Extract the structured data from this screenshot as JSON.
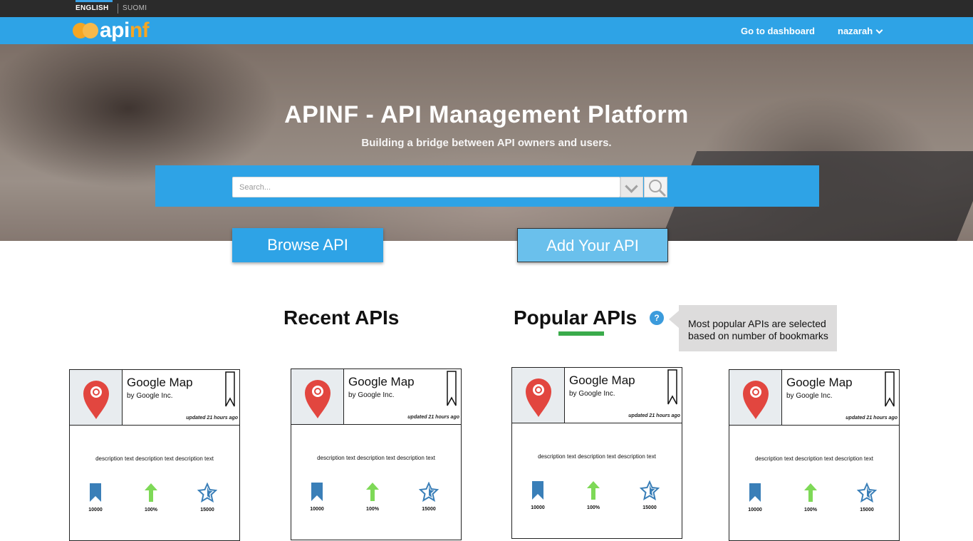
{
  "languages": [
    {
      "label": "ENGLISH"
    },
    {
      "label": "SUOMI"
    }
  ],
  "brand": {
    "name_part1": "api",
    "name_part2": "nf",
    "accent": "#f5a623"
  },
  "nav": {
    "dashboard": "Go to dashboard",
    "user": "nazarah"
  },
  "hero": {
    "title": "APINF - API Management Platform",
    "subtitle": "Building a bridge between API owners and users."
  },
  "search": {
    "placeholder": "Search..."
  },
  "actions": {
    "browse": "Browse API",
    "add": "Add Your API"
  },
  "sections": {
    "recent": "Recent APIs",
    "popular": "Popular APIs",
    "help_icon": "?",
    "tooltip": "Most popular APIs are selected based on number of bookmarks"
  },
  "cards": [
    {
      "name": "Google Map",
      "by": "by Google Inc.",
      "updated": "updated 21 hours ago",
      "description": "description text description text description text",
      "bookmarks": "10000",
      "popularity": "100%",
      "rating": "15000"
    },
    {
      "name": "Google Map",
      "by": "by Google Inc.",
      "updated": "updated 21 hours ago",
      "description": "description text description text description text",
      "bookmarks": "10000",
      "popularity": "100%",
      "rating": "15000"
    },
    {
      "name": "Google Map",
      "by": "by Google Inc.",
      "updated": "updated 21 hours ago",
      "description": "description text description text description text",
      "bookmarks": "10000",
      "popularity": "100%",
      "rating": "15000"
    },
    {
      "name": "Google Map",
      "by": "by Google Inc.",
      "updated": "updated 21 hours ago",
      "description": "description text description text description text",
      "bookmarks": "10000",
      "popularity": "100%",
      "rating": "15000"
    }
  ],
  "colors": {
    "primary": "#2ea3e6",
    "highlight": "#3aab4b",
    "pin": "#e2463f",
    "arrow": "#7ed957",
    "stat_icon": "#3a7fb8"
  }
}
